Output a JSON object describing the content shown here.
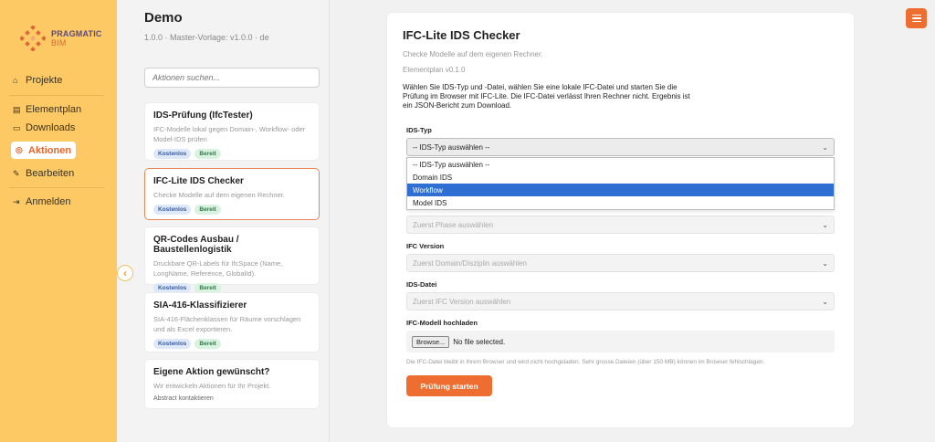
{
  "brand": {
    "line1": "PRAGMATIC",
    "line2": "BIM"
  },
  "nav": {
    "projects": "Projekte",
    "elementplan": "Elementplan",
    "downloads": "Downloads",
    "actions": "Aktionen",
    "edit": "Bearbeiten",
    "login": "Anmelden"
  },
  "project": {
    "title": "Demo",
    "meta": "1.0.0 · Master-Vorlage: v1.0.0 · de"
  },
  "search": {
    "placeholder": "Aktionen suchen..."
  },
  "cards": [
    {
      "title": "IDS-Prüfung (IfcTester)",
      "desc": "IFC-Modelle lokal gegen Domain-, Workflow- oder Model-IDS prüfen",
      "badge1": "Kostenlos",
      "badge2": "Bereit"
    },
    {
      "title": "IFC-Lite IDS Checker",
      "desc": "Checke Modelle auf dem eigenen Rechner.",
      "badge1": "Kostenlos",
      "badge2": "Bereit"
    },
    {
      "title": "QR-Codes Ausbau / Baustellenlogistik",
      "desc": "Druckbare QR-Labels für IfcSpace (Name, LongName, Reference, GlobalId).",
      "badge1": "Kostenlos",
      "badge2": "Bereit"
    },
    {
      "title": "SIA-416-Klassifizierer",
      "desc": "SIA-416-Flächenklassen für Räume vorschlagen und als Excel exportieren.",
      "badge1": "Kostenlos",
      "badge2": "Bereit"
    },
    {
      "title": "Eigene Aktion gewünscht?",
      "desc": "Wir entwickeln Aktionen für Ihr Projekt.",
      "link": "Abstract kontaktieren"
    }
  ],
  "panel": {
    "title": "IFC-Lite IDS Checker",
    "subtitle": "Checke Modelle auf dem eigenen Rechner.",
    "version": "Elementplan   v0.1.0",
    "description": "Wählen Sie IDS-Typ und -Datei, wählen Sie eine lokale IFC-Datei und starten Sie die Prüfung im Browser mit IFC-Lite. Die IFC-Datei verlässt Ihren Rechner nicht. Ergebnis ist ein JSON-Bericht zum Download.",
    "ids_type_label": "IDS-Typ",
    "ids_type_value": "-- IDS-Typ auswählen --",
    "ids_type_options": [
      "-- IDS-Typ auswählen --",
      "Domain IDS",
      "Workflow",
      "Model IDS"
    ],
    "phase_placeholder": "Zuerst Phase auswählen",
    "ifc_version_label": "IFC Version",
    "ifc_version_placeholder": "Zuerst Domain/Disziplin auswählen",
    "ids_file_label": "IDS-Datei",
    "ids_file_placeholder": "Zuerst IFC Version auswählen",
    "upload_label": "IFC-Modell hochladen",
    "browse": "Browse...",
    "no_file": "No file selected.",
    "hint": "Die IFC-Datei bleibt in Ihrem Browser und wird nicht hochgeladen. Sehr grosse Dateien (über 150 MB) können im Browser fehlschlagen.",
    "start": "Prüfung starten"
  }
}
